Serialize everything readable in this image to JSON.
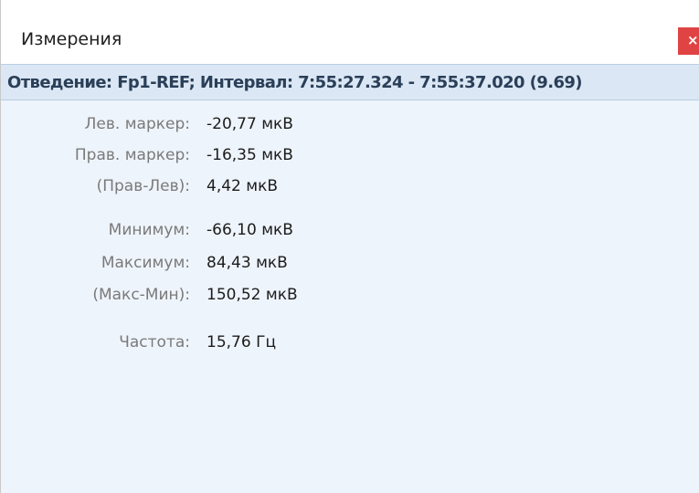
{
  "window": {
    "title": "Измерения",
    "close_label": "×"
  },
  "header": {
    "text": "Отведение: Fp1-REF; Интервал: 7:55:27.324 - 7:55:37.020 (9.69)"
  },
  "measurements": [
    {
      "label": "Лев. маркер:",
      "value": "-20,77 мкВ"
    },
    {
      "label": "Прав. маркер:",
      "value": "-16,35 мкВ"
    },
    {
      "label": "(Прав-Лев):",
      "value": "4,42 мкВ"
    },
    {
      "label": "Минимум:",
      "value": "-66,10 мкВ"
    },
    {
      "label": "Максимум:",
      "value": "84,43 мкВ"
    },
    {
      "label": "(Макс-Мин):",
      "value": "150,52 мкВ"
    },
    {
      "label": "Частота:",
      "value": "15,76 Гц"
    }
  ],
  "colors": {
    "header_bg": "#dbe7f4",
    "content_bg": "#eef4fb",
    "close_button": "#e04343"
  }
}
